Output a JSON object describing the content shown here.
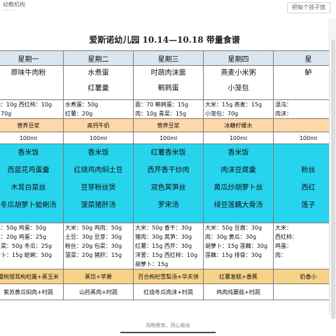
{
  "header": {
    "brand": "幼教机构",
    "slogan": "把每个孩子放"
  },
  "title": "爱斯诺幼儿园 10.14—10.18 带量食谱",
  "days": [
    "星期一",
    "星期二",
    "星期三",
    "星期四",
    "星"
  ],
  "breakfast": [
    [
      "原味牛肉粉",
      ""
    ],
    [
      "水煮蛋",
      "红薯羹"
    ],
    [
      "时蔬肉沫面",
      "鹌鹑蛋"
    ],
    [
      "燕麦小米粥",
      "小笼包"
    ],
    [
      "鲈",
      ""
    ]
  ],
  "breakfast_ingredients": [
    [
      "肉：10g  西红柿：10g",
      "：70g"
    ],
    [
      "水煮蛋：50g",
      "红薯：20g"
    ],
    [
      "面：70  鹌鹑蛋：15g",
      "肉：10g  青菜：15g"
    ],
    [
      "大米：15g  燕麦：15g",
      "小笼包：70g"
    ],
    [
      "混沌：",
      "肉沫："
    ]
  ],
  "morning_snack": [
    "营养豆浆",
    "高钙牛奶",
    "营养豆浆",
    "冰糖柠檬水",
    ""
  ],
  "snack_amount": [
    "100ml",
    "100ml",
    "100ml",
    "100ml",
    "100ml"
  ],
  "lunch": [
    [
      "香米饭",
      "西蓝花鸡蛋羹",
      "木耳白菜丝",
      "冬瓜胡萝卜蛤蜊汤"
    ],
    [
      "香米饭",
      "红烧鸡肉焖土豆",
      "豆芽粉丝煲",
      "菠菜猪肝汤"
    ],
    [
      "红薯香米饭",
      "西芹香干炒肉",
      "双色莴笋丝",
      "罗宋汤"
    ],
    [
      "香米饭",
      "肉沫豆腐羹",
      "黄瓜炒胡萝卜丝",
      "绿豆莲藕大骨汤"
    ],
    [
      "",
      "粉丝",
      "西红",
      "莲子"
    ]
  ],
  "lunch_ingredients": [
    [
      "菜：50g  鸡蛋：50g",
      "耳：20g  鸡蛋：25g",
      "白菜：50g  冬瓜：25g",
      "萝卜：15g  蛤蜊：50g"
    ],
    [
      "大米：50g  鸡肉：50g",
      "土豆：30g  豆芽：30g",
      "粉丝：20g  包菜：30g",
      "菠菜：20g  猪肝：15g"
    ],
    [
      "大米：50g  香干：30g",
      "猪肉：30g  莴笋：30g",
      "红薯：15g  西芹：30g",
      "洋葱：15g  西红柿：10g",
      "胡萝卜：15g"
    ],
    [
      "大米：50g  豆腐：30g",
      "肉：30g  黄瓜：30g",
      "胡萝卜：15g  莲藕：30g",
      "莲藕：15g  排骨：30g"
    ],
    [
      "大米：",
      "西红柿：",
      "鸡蛋：",
      "肉："
    ]
  ],
  "afternoon_snack": [
    "樱桃银耳枸杞羹+蒸玉米",
    "蒸饺+苹果",
    "百合枸杞雪梨汤+华夫饼",
    "红薯发糕+香蕉",
    "奶香小"
  ],
  "dinner": [
    "紫苏黄瓜焖肉+时蔬",
    "山药蒸肉+时蔬",
    "红烧冬瓜肉沫+时蔬",
    "鸡肉炖蘑菇+时蔬",
    ""
  ],
  "footer": "用眼教育，用心栽培"
}
